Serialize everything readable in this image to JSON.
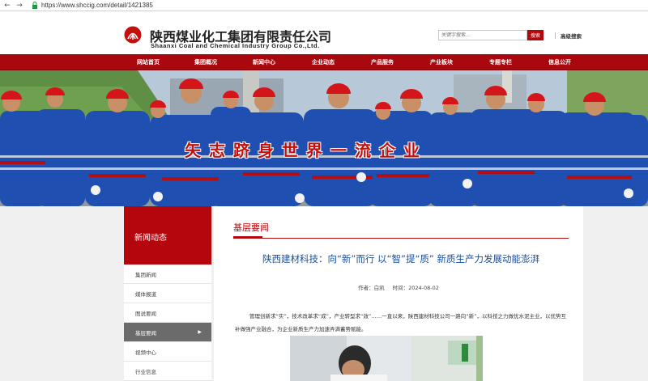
{
  "browser": {
    "url": "https://www.shccig.com/detail/1421385"
  },
  "header": {
    "logo_cn": "陕西煤业化工集团有限责任公司",
    "logo_en": "Shaanxi Coal and Chemical Industry Group Co.,Ltd.",
    "search_placeholder": "关键字搜索...",
    "search_button": "搜索",
    "advanced_search": "高级搜索"
  },
  "nav": {
    "items": [
      {
        "label": "网站首页"
      },
      {
        "label": "集团概况"
      },
      {
        "label": "新闻中心"
      },
      {
        "label": "企业动态"
      },
      {
        "label": "产品服务"
      },
      {
        "label": "产业板块"
      },
      {
        "label": "专题专栏"
      },
      {
        "label": "信息公开"
      }
    ]
  },
  "banner": {
    "slogan": "矢志跻身世界一流企业"
  },
  "sidebar": {
    "title": "新闻动态",
    "items": [
      {
        "label": "集团新闻"
      },
      {
        "label": "媒体报道"
      },
      {
        "label": "图说要闻"
      },
      {
        "label": "基层要闻"
      },
      {
        "label": "视频中心"
      },
      {
        "label": "行业信息"
      }
    ],
    "active_arrow": "▶"
  },
  "main": {
    "section_title": "基层要闻",
    "article_title": "陕西建材科技：向“新”而行 以“智”提“质” 新质生产力发展动能澎湃",
    "author_label": "作者：",
    "author": "白凯",
    "time_label": "时间：",
    "time": "2024-08-02",
    "paragraph": "管理创新求“实”，技术改革求“成”，产业转型求“效”……一直以来，陕西建材科技公司一路向“新”，以科技之力做优水泥主业，以优势互补做强产业融合，为企业新质生产力加速弄满蓄势赋能。"
  },
  "colors": {
    "brand_red": "#b5060d",
    "nav_red": "#a8080e",
    "title_blue": "#1a4f9a",
    "active_gray": "#6b6b6b"
  }
}
